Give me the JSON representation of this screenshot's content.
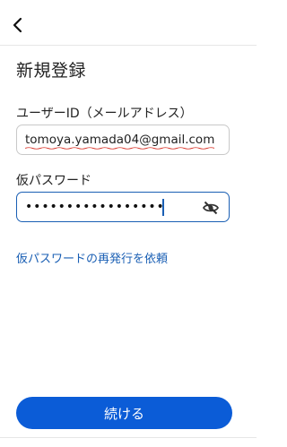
{
  "header": {
    "back_icon": "chevron-left-icon"
  },
  "page": {
    "title": "新規登録"
  },
  "form": {
    "email": {
      "label": "ユーザーID（メールアドレス）",
      "value": "tomoya.yamada04@gmail.com"
    },
    "password": {
      "label": "仮パスワード",
      "masked_value": "•••••••••••••••••",
      "toggle_icon": "eye-slash-icon"
    }
  },
  "links": {
    "reissue": "仮パスワードの再発行を依頼"
  },
  "actions": {
    "continue_label": "続ける"
  },
  "colors": {
    "accent": "#0b5cd7",
    "link": "#1a5fb4",
    "border": "#c9c9c9"
  }
}
